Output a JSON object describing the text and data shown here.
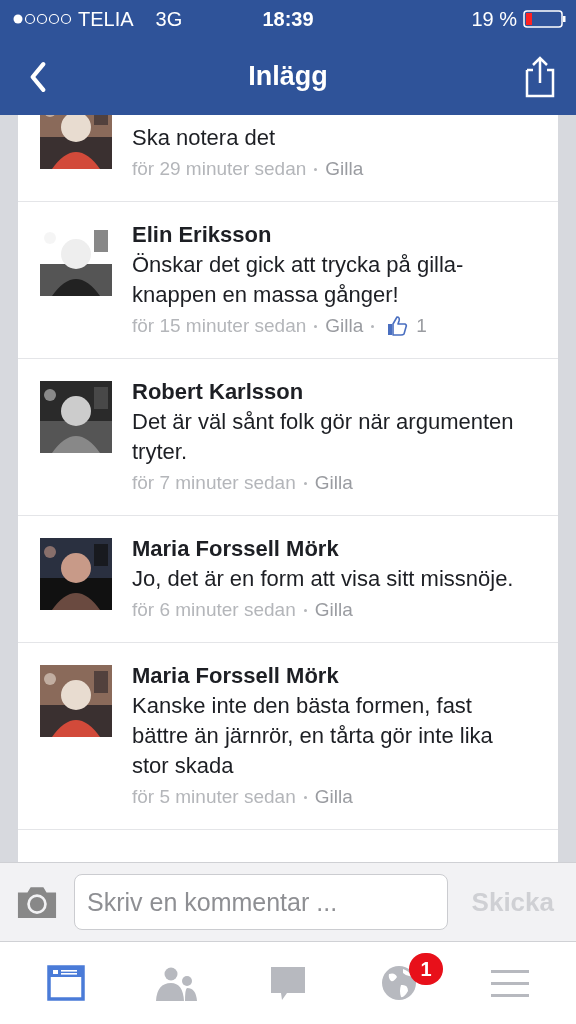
{
  "status_bar": {
    "carrier": "TELIA",
    "network": "3G",
    "time": "18:39",
    "battery": "19 %"
  },
  "nav": {
    "title": "Inlägg"
  },
  "comments": [
    {
      "text": "Ska notera det",
      "time": "för 29 minuter sedan",
      "action": "Gilla"
    },
    {
      "name": "Elin Eriksson",
      "text": "Önskar det gick att trycka på gilla-knappen en massa gånger!",
      "time": "för 15 minuter sedan",
      "action": "Gilla",
      "likes": "1"
    },
    {
      "name": "Robert Karlsson",
      "text": "Det är väl sånt folk gör när argumenten tryter.",
      "time": "för 7 minuter sedan",
      "action": "Gilla"
    },
    {
      "name": "Maria Forssell Mörk",
      "text": "Jo, det är en form att visa sitt missnöje.",
      "time": "för 6 minuter sedan",
      "action": "Gilla"
    },
    {
      "name": "Maria Forssell Mörk",
      "text": "Kanske inte den bästa formen, fast bättre än järnrör, en tårta gör inte lika stor skada",
      "time": "för 5 minuter sedan",
      "action": "Gilla"
    }
  ],
  "composer": {
    "placeholder": "Skriv en kommentar ...",
    "send": "Skicka"
  },
  "tab_bar": [
    {
      "kind": "feed",
      "selected": true
    },
    {
      "kind": "friends",
      "selected": false
    },
    {
      "kind": "messages",
      "selected": false
    },
    {
      "kind": "notifications",
      "selected": false,
      "badge": "1"
    },
    {
      "kind": "menu",
      "selected": false
    }
  ]
}
